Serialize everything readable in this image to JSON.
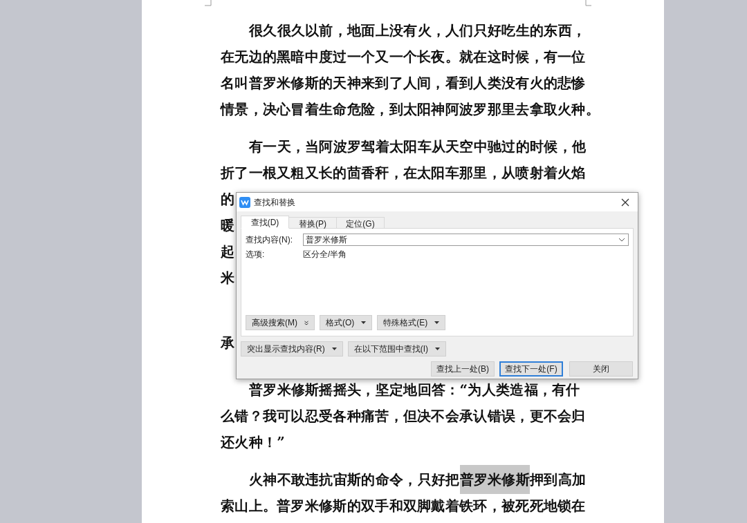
{
  "document": {
    "paragraphs": [
      {
        "lines": [
          {
            "indent": true,
            "segments": [
              {
                "text": "很久很久以前，地面上没有火，人们只好吃生的东西，",
                "highlighted": false
              }
            ]
          },
          {
            "indent": false,
            "segments": [
              {
                "text": "在无边的黑暗中度过一个又一个长夜。就在这时候，有一位",
                "highlighted": false
              }
            ]
          },
          {
            "indent": false,
            "segments": [
              {
                "text": "名叫普罗米修斯的天神来到了人间，看到人类没有火的悲惨",
                "highlighted": false
              }
            ]
          },
          {
            "indent": false,
            "segments": [
              {
                "text": "情景，决心冒着生命危险，到太阳神阿波罗那里去拿取火种。",
                "highlighted": false
              }
            ]
          }
        ]
      },
      {
        "lines": [
          {
            "indent": true,
            "segments": [
              {
                "text": "有一天，当阿波罗驾着太阳车从天空中驰过的时候，他",
                "highlighted": false
              }
            ]
          },
          {
            "indent": false,
            "segments": [
              {
                "text": "折了一根又粗又长的茴香秆，在太阳车那里，从喷射着火焰",
                "highlighted": false
              }
            ]
          },
          {
            "indent": false,
            "segments": [
              {
                "text": "的",
                "highlighted": false
              }
            ]
          },
          {
            "indent": false,
            "segments": [
              {
                "text": "暖",
                "highlighted": false
              }
            ]
          },
          {
            "indent": false,
            "segments": [
              {
                "text": "起",
                "highlighted": false
              }
            ]
          },
          {
            "indent": false,
            "segments": [
              {
                "text": "米",
                "highlighted": false
              }
            ]
          }
        ]
      },
      {
        "lines": [
          {
            "indent": false,
            "segments": [
              {
                "text": "承",
                "highlighted": false
              }
            ]
          }
        ]
      },
      {
        "lines": [
          {
            "indent": true,
            "segments": [
              {
                "text": "普罗米修斯摇摇头，坚定地回答：“为人类造福，有什",
                "highlighted": false
              }
            ]
          },
          {
            "indent": false,
            "segments": [
              {
                "text": "么错？我可以忍受各种痛苦，但决不会承认错误，更不会归",
                "highlighted": false
              }
            ]
          },
          {
            "indent": false,
            "segments": [
              {
                "text": "还火种！”",
                "highlighted": false
              }
            ]
          }
        ]
      },
      {
        "lines": [
          {
            "indent": true,
            "segments": [
              {
                "text": "火神不敢违抗宙斯的命令，只好把",
                "highlighted": false
              },
              {
                "text": "普罗米修斯",
                "highlighted": true
              },
              {
                "text": "押到高加",
                "highlighted": false
              }
            ]
          },
          {
            "indent": false,
            "segments": [
              {
                "text": "索山上。普罗米修斯的双手和双脚戴着铁环，被死死地锁在",
                "highlighted": false
              }
            ]
          }
        ]
      }
    ]
  },
  "dialog": {
    "title": "查找和替换",
    "tabs": [
      {
        "label": "查找(D)",
        "selected": true
      },
      {
        "label": "替换(P)",
        "selected": false
      },
      {
        "label": "定位(G)",
        "selected": false
      }
    ],
    "find_label": "查找内容(N):",
    "find_value": "普罗米修斯",
    "options_label": "选项:",
    "options_value": "区分全/半角",
    "panel_buttons": [
      {
        "label": "高级搜索(M)",
        "kind": "expand"
      },
      {
        "label": "格式(O)",
        "kind": "dropdown"
      },
      {
        "label": "特殊格式(E)",
        "kind": "dropdown"
      }
    ],
    "lower_buttons": [
      {
        "label": "突出显示查找内容(R)",
        "kind": "dropdown"
      },
      {
        "label": "在以下范围中查找(I)",
        "kind": "dropdown"
      }
    ],
    "action_buttons": [
      {
        "label": "查找上一处(B)",
        "focused": false
      },
      {
        "label": "查找下一处(F)",
        "focused": true
      },
      {
        "label": "关闭",
        "focused": false
      }
    ]
  }
}
